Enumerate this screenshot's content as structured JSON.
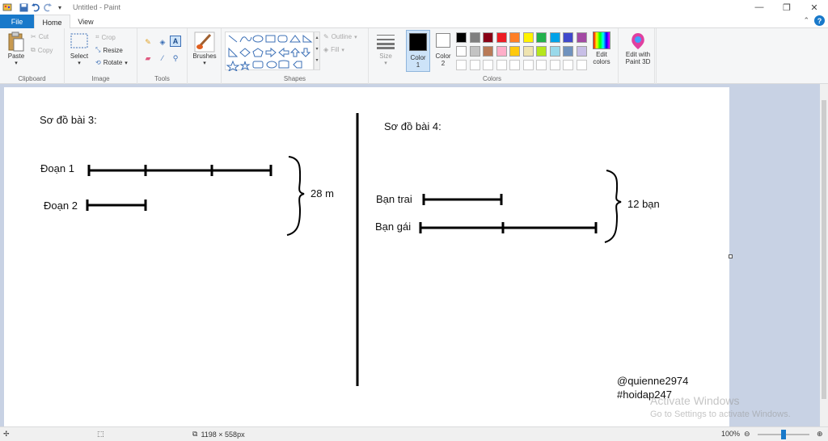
{
  "window": {
    "title": "Untitled - Paint",
    "minimize": "—",
    "maximize": "❐",
    "close": "✕"
  },
  "tabs": [
    {
      "label": "File"
    },
    {
      "label": "Home"
    },
    {
      "label": "View"
    }
  ],
  "ribbon": {
    "clipboard": {
      "label": "Clipboard",
      "paste": "Paste",
      "cut": "Cut",
      "copy": "Copy"
    },
    "image": {
      "label": "Image",
      "select": "Select",
      "crop": "Crop",
      "resize": "Resize",
      "rotate": "Rotate"
    },
    "tools": {
      "label": "Tools"
    },
    "brushes": {
      "label": "Brushes"
    },
    "shapes": {
      "label": "Shapes",
      "outline": "Outline",
      "fill": "Fill"
    },
    "size": {
      "label": "Size"
    },
    "colors": {
      "label": "Colors",
      "color1_label": "Color",
      "color1_num": "1",
      "color2_label": "Color",
      "color2_num": "2",
      "color1": "#000000",
      "color2": "#ffffff",
      "palette_row1": [
        "#000000",
        "#7f7f7f",
        "#880015",
        "#ed1c24",
        "#ff7f27",
        "#fff200",
        "#22b14c",
        "#00a2e8",
        "#3f48cc",
        "#a349a4"
      ],
      "palette_row2": [
        "#ffffff",
        "#c3c3c3",
        "#b97a57",
        "#ffaec9",
        "#ffc90e",
        "#efe4b0",
        "#b5e61d",
        "#99d9ea",
        "#7092be",
        "#c8bfe7"
      ],
      "edit_colors_line1": "Edit",
      "edit_colors_line2": "colors",
      "paint3d_line1": "Edit with",
      "paint3d_line2": "Paint 3D"
    }
  },
  "canvas": {
    "left_title": "Sơ đồ bài 3:",
    "seg1_label": "Đoạn 1",
    "seg2_label": "Đoạn 2",
    "left_total": "28 m",
    "right_title": "Sơ đồ bài 4:",
    "boys_label": "Bạn trai",
    "girls_label": "Bạn gái",
    "right_total": "12 bạn",
    "credit1": "@quienne2974",
    "credit2": "#hoidap247"
  },
  "watermark": {
    "line1": "Activate Windows",
    "line2": "Go to Settings to activate Windows."
  },
  "status": {
    "dimensions": "1198 × 558px",
    "zoom": "100%",
    "zoom_fraction": 0.5
  }
}
